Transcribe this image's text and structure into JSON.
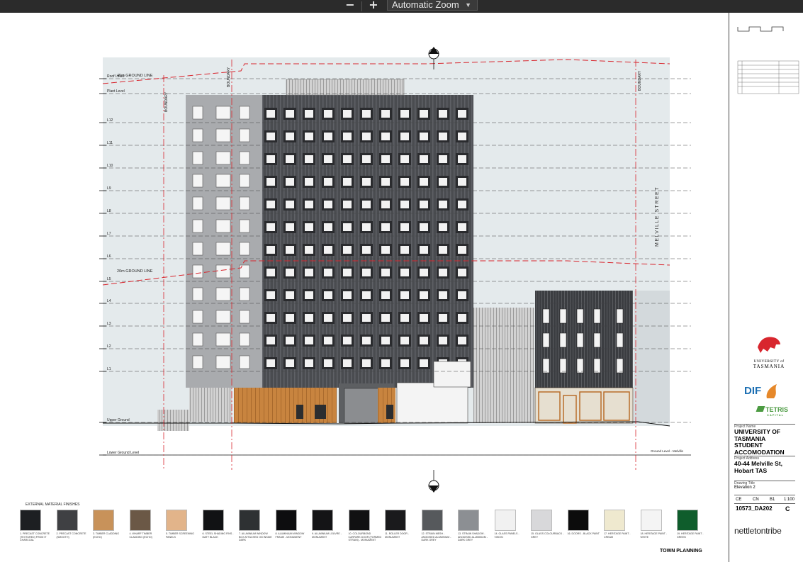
{
  "toolbar": {
    "zoom_out": "−",
    "zoom_in": "+",
    "zoom_select": "Automatic Zoom",
    "caret": "⌃"
  },
  "drawing": {
    "level_labels": [
      "Roof Level",
      "Plant Level",
      "L12",
      "L11",
      "L10",
      "L9",
      "L8",
      "L7",
      "L6",
      "L5",
      "L4",
      "L3",
      "L2",
      "L1",
      "Upper Ground",
      "Lower Ground Level"
    ],
    "ground_line_45": "45m GROUND LINE",
    "ground_line_20": "20m GROUND LINE",
    "boundary": "BOUNDARY",
    "melville_street": "MELVILLE STREET",
    "ground_level_melville": "Ground Level - Melville"
  },
  "materials": {
    "title": "EXTERNAL MATERIAL FINISHES",
    "items": [
      {
        "label": "1. PRECAST CONCRETE (TEXTURED) FROM IT CHARCOAL",
        "color": "#1d1f22"
      },
      {
        "label": "2. PRECAST CONCRETE (SMOOTH)",
        "color": "#3f4043"
      },
      {
        "label": "3. TIMBER CLADDING (ECHO)",
        "color": "#c8925a"
      },
      {
        "label": "4. WHARF TIMBER CLADDING (ECHO)",
        "color": "#6b5846"
      },
      {
        "label": "5. TIMBER SCREENING PANELS",
        "color": "#e2b48a"
      },
      {
        "label": "6. STEEL SHADING FINS - MATT BLACK",
        "color": "#111214"
      },
      {
        "label": "7. ALUMINIUM WINDOW BOX ATTACHED ON INSIDE DARK",
        "color": "#2e3133"
      },
      {
        "label": "8. ALUMINIUM WINDOW FRAME - MONUMENT",
        "color": "#0d0d0f"
      },
      {
        "label": "9. ALUMINIUM LOUVRE - MONUMENT",
        "color": "#141416"
      },
      {
        "label": "10. COLOURBOND CARPARK DOOR (FORMED STRAIN) - MONUMENT",
        "color": "#111112"
      },
      {
        "label": "11. ROLLER DOOR - MONUMENT",
        "color": "#1a1a1c"
      },
      {
        "label": "12. STRAIN MESH - ANODISED ALUMINIUM - DARK GREY",
        "color": "#56595c"
      },
      {
        "label": "13. STRAIN SHADOW - ANODISED ALUMINIUM - DARK GREY",
        "color": "#8c8f93"
      },
      {
        "label": "14. GLASS PANELS - VISION",
        "color": "#f1f1f1"
      },
      {
        "label": "15. GLASS COLOURBACK - GREY",
        "color": "#d8d8da"
      },
      {
        "label": "16. DOORS - BLACK PAINT",
        "color": "#0c0c0c"
      },
      {
        "label": "17. HERITAGE PAINT - CREAM",
        "color": "#efe9cf"
      },
      {
        "label": "18. HERITAGE PAINT - WHITE",
        "color": "#f4f4f4"
      },
      {
        "label": "19. HERITAGE PAINT - GREEN",
        "color": "#0f5d2c"
      }
    ]
  },
  "title_block": {
    "university_line1": "UNIVERSITY of",
    "university_line2": "TASMANIA",
    "dif": "DIF",
    "tetris": "TETRIS",
    "tetris_sub": "CAPITAL",
    "project_name_label": "Project Name",
    "project_name": "UNIVERSITY OF TASMANIA STUDENT ACCOMODATION",
    "project_address_label": "Project Address",
    "project_address": "40-44 Melville St, Hobart TAS",
    "drawing_title_label": "Drawing Title",
    "drawing_title": "Elevation 2",
    "drawn": "CE",
    "checked": "CN",
    "size": "B1",
    "scale": "1:100",
    "drawing_no": "10573_DA202",
    "revision": "C",
    "firm": "nettletontribe",
    "stage": "TOWN PLANNING"
  },
  "colors": {
    "toolbar_bg": "#2b2b2b",
    "accent_red": "#d8262e",
    "dif_blue": "#1c6fb3",
    "tetris_green": "#4c9b42"
  }
}
